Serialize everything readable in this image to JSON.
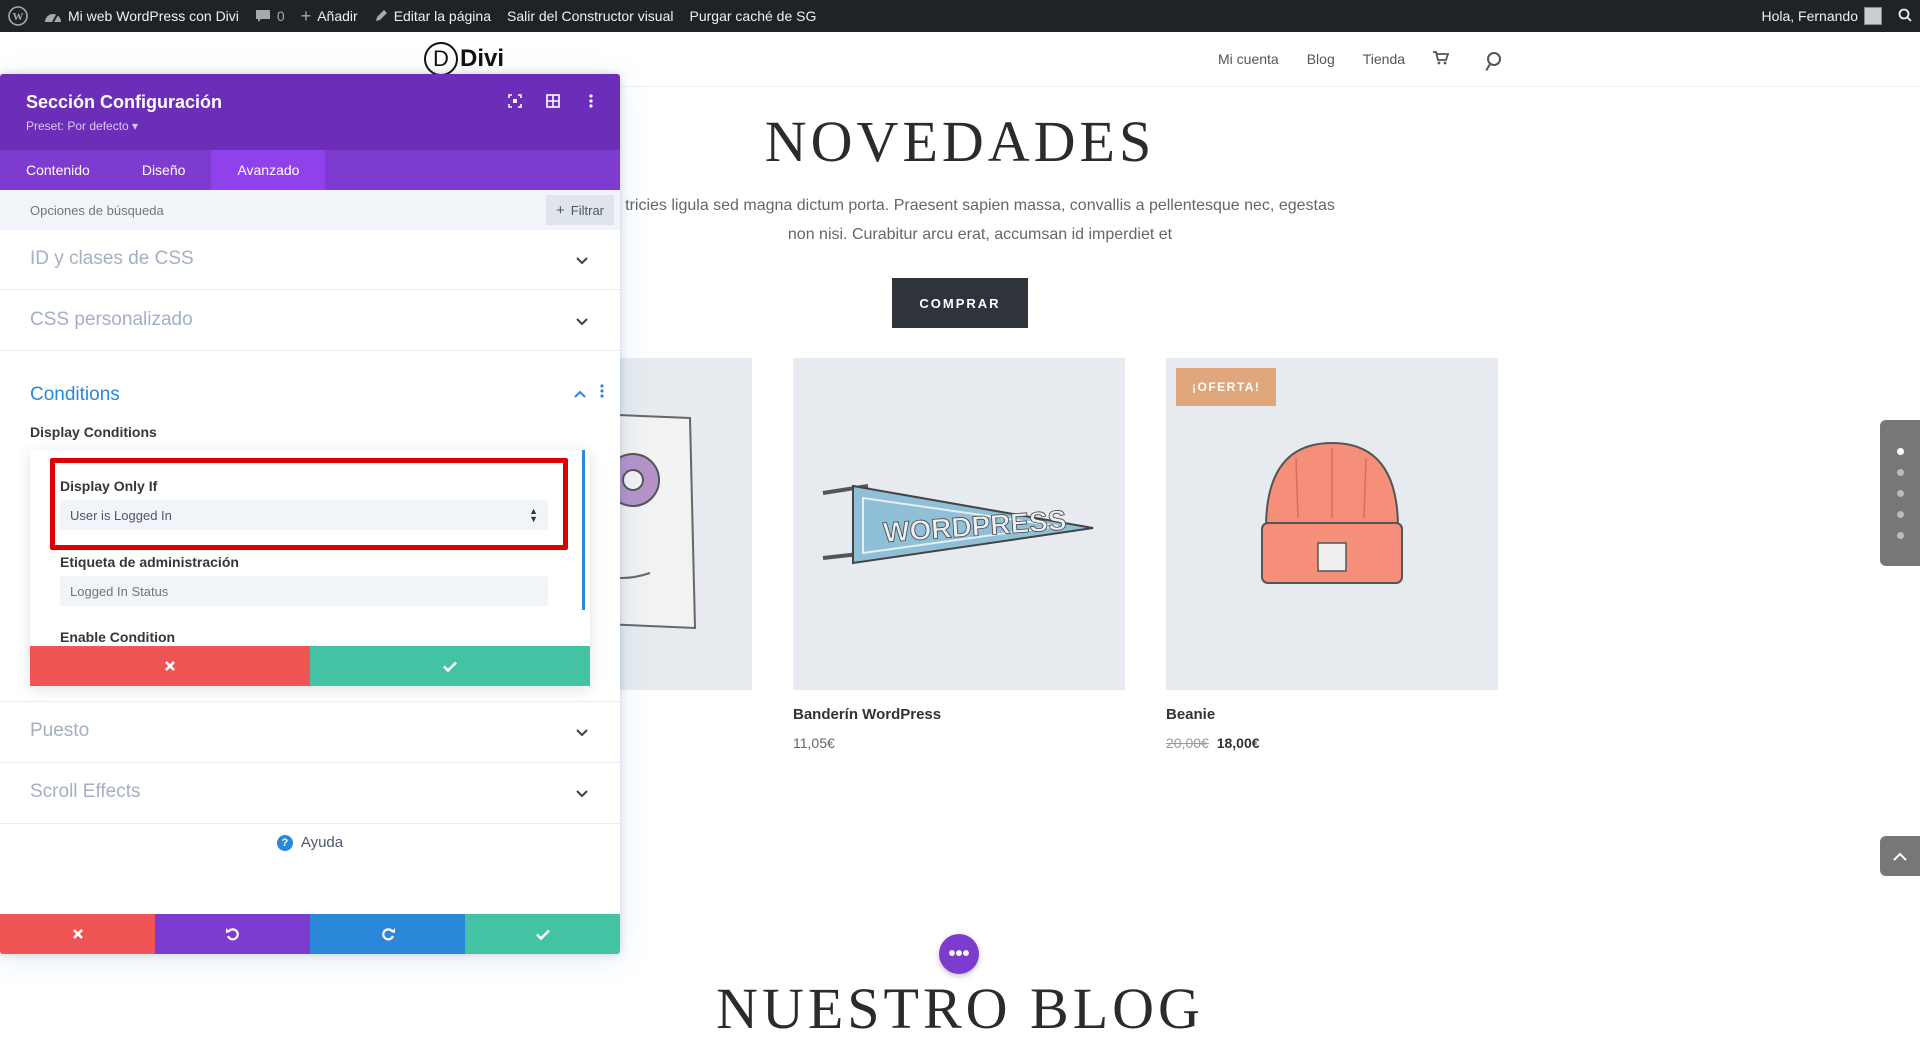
{
  "adminbar": {
    "site_name": "Mi web WordPress con Divi",
    "comments_count": "0",
    "add_new": "Añadir",
    "edit_page": "Editar la página",
    "exit_builder": "Salir del Constructor visual",
    "purge_cache": "Purgar caché de SG",
    "greeting": "Hola, Fernando"
  },
  "header": {
    "logo_text": "Divi",
    "logo_letter": "D",
    "nav": [
      "Mi cuenta",
      "Blog",
      "Tienda"
    ]
  },
  "page": {
    "hero_title": "NOVEDADES",
    "hero_text_line1": "tricies ligula sed magna dictum porta. Praesent sapien massa, convallis a pellentesque nec, egestas",
    "hero_text_line2": "non nisi. Curabitur arcu erat, accumsan id imperdiet et",
    "cta": "COMPRAR",
    "products": [
      {
        "name": "",
        "price": ""
      },
      {
        "name": "Banderín WordPress",
        "price": "11,05€"
      },
      {
        "name": "Beanie",
        "old_price": "20,00€",
        "price": "18,00€",
        "badge": "¡OFERTA!"
      }
    ],
    "blog_title": "NUESTRO BLOG",
    "fab_icon": "•••"
  },
  "modal": {
    "title": "Sección Configuración",
    "preset": "Preset: Por defecto ▾",
    "tabs": [
      "Contenido",
      "Diseño",
      "Avanzado"
    ],
    "active_tab": "Avanzado",
    "search_placeholder": "Opciones de búsqueda",
    "filter_label": "Filtrar",
    "toggles": {
      "css_id": "ID y clases de CSS",
      "css_custom": "CSS personalizado",
      "conditions": "Conditions",
      "position": "Puesto",
      "scroll": "Scroll Effects"
    },
    "conditions": {
      "section_label": "Display Conditions",
      "display_only_if_label": "Display Only If",
      "display_only_if_value": "User is Logged In",
      "admin_label_label": "Etiqueta de administración",
      "admin_label_placeholder": "Logged In Status",
      "enable_condition_label": "Enable Condition"
    },
    "help": "Ayuda"
  },
  "colors": {
    "purple_dark": "#6c2eb9",
    "purple": "#7e3bd0",
    "blue": "#2b87da",
    "red": "#ef5555",
    "green": "#43c3a3",
    "highlight": "#e00000"
  }
}
